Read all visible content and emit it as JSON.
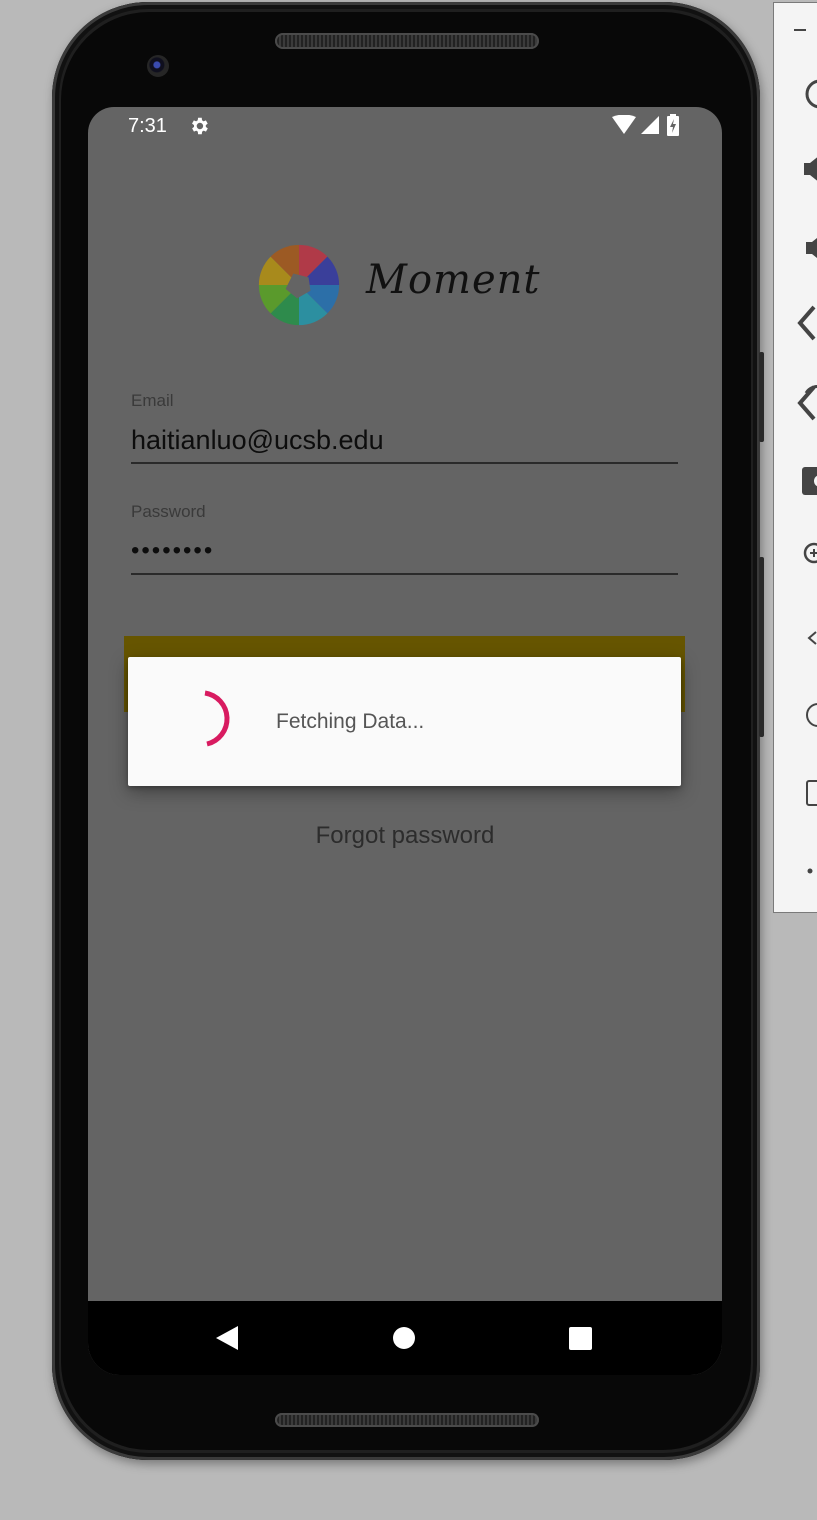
{
  "status_bar": {
    "time": "7:31",
    "icons": [
      "gear-icon",
      "wifi-icon",
      "cell-signal-icon",
      "battery-charging-icon"
    ]
  },
  "app": {
    "title": "Moment",
    "logo": "aperture-logo"
  },
  "form": {
    "email_label": "Email",
    "email_value": "haitianluo@ucsb.edu",
    "password_label": "Password",
    "password_value": "••••••••"
  },
  "login_button": {
    "label": "",
    "color": "#665500"
  },
  "forgot_password": "Forgot password",
  "dialog": {
    "message": "Fetching Data...",
    "spinner_color": "#d81b60"
  },
  "nav_bar": {
    "buttons": [
      "back-icon",
      "home-icon",
      "recents-icon"
    ]
  },
  "emulator_toolbar": {
    "items": [
      "minimize-icon",
      "power-icon",
      "volume-up-icon",
      "volume-down-icon",
      "rotate-left-icon",
      "rotate-right-icon",
      "camera-icon",
      "zoom-in-icon",
      "back-icon",
      "home-icon",
      "overview-icon",
      "more-icon"
    ]
  },
  "colors": {
    "screen_overlay": "#646464",
    "dialog_bg": "#fafafa",
    "accent": "#d81b60"
  }
}
